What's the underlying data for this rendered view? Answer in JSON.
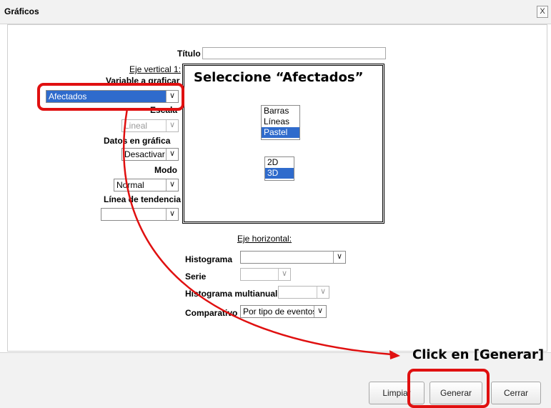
{
  "window": {
    "title": "Gráficos",
    "close_label": "X"
  },
  "form": {
    "titulo_label": "Título",
    "titulo_value": "",
    "eje_vertical_label": "Eje vertical 1:",
    "variable_label": "Variable a graficar",
    "variable_value": "Afectados",
    "escala_label": "Escala",
    "escala_value": "Lineal",
    "datos_label": "Datos en gráfica",
    "datos_value": "Desactivar",
    "modo_label": "Modo",
    "modo_value": "Normal",
    "tendencia_label": "Línea de tendencia",
    "tendencia_value": "",
    "chart_types": [
      {
        "label": "Barras",
        "selected": false
      },
      {
        "label": "Líneas",
        "selected": false
      },
      {
        "label": "Pastel",
        "selected": true
      }
    ],
    "dimensions": [
      {
        "label": "2D",
        "selected": false
      },
      {
        "label": "3D",
        "selected": true
      }
    ],
    "eje_horizontal_label": "Eje horizontal:",
    "histograma_label": "Histograma",
    "histograma_value": "",
    "serie_label": "Serie",
    "serie_value": "",
    "multianual_label": "Histograma multianual",
    "multianual_value": "",
    "comparativo_label": "Comparativo",
    "comparativo_value": "Por tipo de eventos"
  },
  "buttons": {
    "limpiar": "Limpiar",
    "generar": "Generar",
    "cerrar": "Cerrar"
  },
  "annotations": {
    "select_hint": "Seleccione “Afectados”",
    "click_hint": "Click en [Generar]",
    "color": "#e01010"
  },
  "colors": {
    "selection": "#2f6bcc",
    "panel_bg": "#f2f2f2"
  }
}
